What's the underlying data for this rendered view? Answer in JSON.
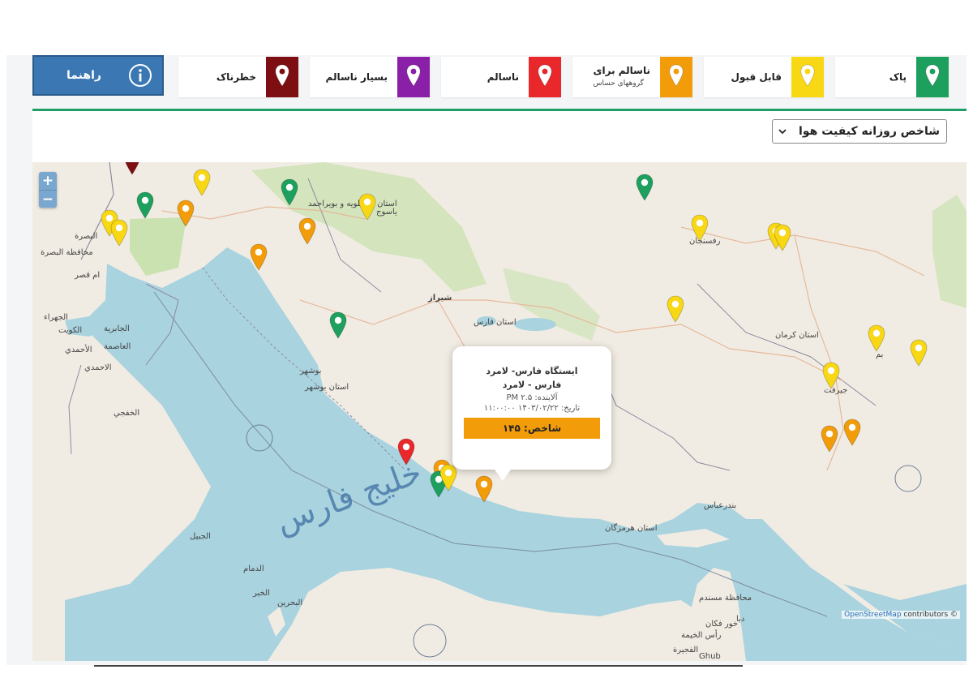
{
  "legend": {
    "items": [
      {
        "id": "clean",
        "label": "پاک",
        "color": "#1da05e"
      },
      {
        "id": "acceptable",
        "label": "قابل قبول",
        "color": "#f8d714"
      },
      {
        "id": "sensitive",
        "label": "ناسالم برای",
        "sub": "گروههای حساس",
        "color": "#f39c0a"
      },
      {
        "id": "unhealthy",
        "label": "ناسالم",
        "color": "#e8282b"
      },
      {
        "id": "very_unhealthy",
        "label": "بسیار ناسالم",
        "color": "#8a1fa8"
      },
      {
        "id": "hazardous",
        "label": "خطرناک",
        "color": "#7d0f12"
      }
    ],
    "help_label": "راهنما"
  },
  "filter": {
    "selected": "شاخص روزانه کیفیت هوا"
  },
  "map": {
    "colors": {
      "water": "#a9d3df",
      "land": "#f1ece3",
      "park": "#c9e2b0",
      "border": "#8e8aa0"
    },
    "zoom_in": "+",
    "zoom_out": "−",
    "gulf_label": "خلیج فارس",
    "places": {
      "basra": "البصرة",
      "basra_prov": "محافظة البصرة",
      "umm_qasr": "ام قصر",
      "jahra": "الجهراء",
      "kuwait": "الكويت",
      "jabriya": "الجابرية",
      "ahmadi": "الأحمدي",
      "ahmadi2": "الاحمدي",
      "asimah": "العاصمة",
      "khafji": "الخفجي",
      "jubail": "الجبيل",
      "dammam": "الدمام",
      "bahrain": "البحرين",
      "khobar": "الخبر",
      "kohgiluyeh": "استان کهگیلویه و بویراحمد",
      "yasuj": "یاسوج",
      "shiraz": "شیراز",
      "fars": "استان فارس",
      "bushehr": "بوشهر",
      "bushehr_prov": "استان بوشهر",
      "rafsanjan": "رفسنجان",
      "kerman_prov": "استان کرمان",
      "bam": "بم",
      "jiroft": "جیرفت",
      "bandar_abbas": "بندرعباس",
      "hormozgan": "استان هرمزگان",
      "musandam": "محافظة مسندم",
      "diba": "دبا",
      "ras_khaimah": "رأس الخيمة",
      "khor_fakkan": "خور فكان",
      "fujairah": "الفجيرة",
      "ghub": "Ghub"
    },
    "popup": {
      "station": "ایستگاه فارس- لامرد",
      "location": "فارس - لامرد",
      "pollutant": "آلاینده: PM ۲.۵",
      "date": "تاریخ: ۱۴۰۳/۰۲/۲۲ ۱۱:۰۰:۰۰",
      "index_label": "شاخص: ۱۴۵",
      "index_value": 145,
      "index_color": "#f39c0a"
    },
    "attribution": {
      "link": "OpenStreetMap",
      "suffix": " contributors ©"
    },
    "markers": [
      {
        "category": "hazardous"
      },
      {
        "category": "acceptable"
      },
      {
        "category": "clean"
      },
      {
        "category": "sensitive"
      },
      {
        "category": "acceptable"
      },
      {
        "category": "acceptable"
      },
      {
        "category": "clean"
      },
      {
        "category": "sensitive"
      },
      {
        "category": "acceptable"
      },
      {
        "category": "sensitive"
      },
      {
        "category": "sensitive"
      },
      {
        "category": "clean"
      },
      {
        "category": "clean"
      },
      {
        "category": "acceptable"
      },
      {
        "category": "acceptable"
      },
      {
        "category": "acceptable"
      },
      {
        "category": "acceptable"
      },
      {
        "category": "acceptable"
      },
      {
        "category": "acceptable"
      },
      {
        "category": "acceptable"
      },
      {
        "category": "sensitive"
      },
      {
        "category": "sensitive"
      },
      {
        "category": "unhealthy"
      },
      {
        "category": "sensitive"
      },
      {
        "category": "clean"
      },
      {
        "category": "acceptable"
      },
      {
        "category": "sensitive"
      }
    ]
  }
}
